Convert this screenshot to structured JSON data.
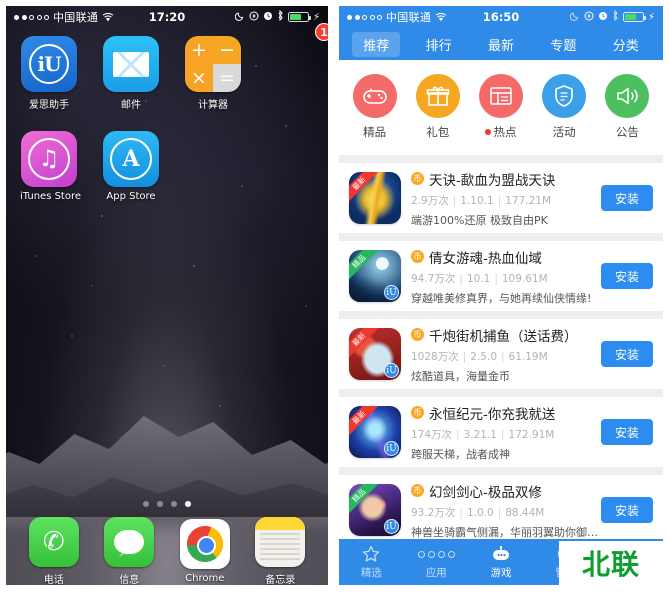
{
  "left_phone": {
    "status_bar": {
      "carrier": "中国联通",
      "signal_dots_filled": 2,
      "signal_dots_total": 5,
      "wifi_icon": "wifi-icon",
      "time": "17:20",
      "moon_icon": "do-not-disturb-icon",
      "rotation_lock_icon": "rotation-lock-icon",
      "alarm_icon": "alarm-icon",
      "bluetooth_icon": "bluetooth-icon",
      "battery_icon": "battery-icon",
      "charging_icon": "charging-bolt-icon"
    },
    "apps": [
      {
        "label": "爱思助手",
        "icon": "aisi-helper-icon",
        "glyph": "iU",
        "badge": "1"
      },
      {
        "label": "邮件",
        "icon": "mail-icon",
        "glyph": "",
        "badge": ""
      },
      {
        "label": "计算器",
        "icon": "calculator-icon",
        "keys": [
          "+",
          "−",
          "×",
          "="
        ],
        "badge": ""
      },
      {
        "label": "iTunes Store",
        "icon": "itunes-store-icon",
        "glyph": "♫",
        "badge": ""
      },
      {
        "label": "App Store",
        "icon": "app-store-icon",
        "glyph": "A",
        "badge": ""
      }
    ],
    "page_dots": {
      "total": 4,
      "active_index": 3
    },
    "dock": [
      {
        "label": "电话",
        "icon": "phone-icon",
        "glyph": "✆"
      },
      {
        "label": "信息",
        "icon": "messages-icon",
        "glyph": ""
      },
      {
        "label": "Chrome",
        "icon": "chrome-icon",
        "glyph": ""
      },
      {
        "label": "备忘录",
        "icon": "notes-icon",
        "glyph": ""
      }
    ]
  },
  "right_phone": {
    "status_bar": {
      "carrier": "中国联通",
      "signal_dots_filled": 2,
      "signal_dots_total": 5,
      "wifi_icon": "wifi-icon",
      "time": "16:50",
      "battery_icon": "battery-icon"
    },
    "tabs": [
      {
        "label": "推荐",
        "active": true
      },
      {
        "label": "排行",
        "active": false
      },
      {
        "label": "最新",
        "active": false
      },
      {
        "label": "专题",
        "active": false
      },
      {
        "label": "分类",
        "active": false
      }
    ],
    "categories": [
      {
        "label": "精品",
        "icon": "game-controller-icon",
        "color": "#f36a68",
        "dot": false
      },
      {
        "label": "礼包",
        "icon": "gift-box-icon",
        "color": "#f5a623",
        "dot": false
      },
      {
        "label": "热点",
        "icon": "hot-news-icon",
        "color": "#f36a68",
        "dot": true
      },
      {
        "label": "活动",
        "icon": "shield-activity-icon",
        "color": "#3aa0e8",
        "dot": false
      },
      {
        "label": "公告",
        "icon": "megaphone-icon",
        "color": "#4cbf5f",
        "dot": false
      }
    ],
    "apps": [
      {
        "ribbon": "最新",
        "ribbon_type": "new",
        "title": "天诀-歃血为盟战天诀",
        "downloads": "2.9万次",
        "version": "1.10.1",
        "size": "177.21M",
        "desc": "端游100%还原 极致自由PK",
        "install_label": "安装",
        "icon": "game-icon-tianjue"
      },
      {
        "ribbon": "精品",
        "ribbon_type": "fine",
        "title": "倩女游魂-热血仙域",
        "downloads": "94.7万次",
        "version": "10.1",
        "size": "109.61M",
        "desc": "穿越唯美修真界，与她再续仙侠情缘!",
        "install_label": "安装",
        "icon": "game-icon-qiannv"
      },
      {
        "ribbon": "最新",
        "ribbon_type": "new",
        "title": "千炮街机捕鱼（送话费）",
        "downloads": "1028万次",
        "version": "2.5.0",
        "size": "61.19M",
        "desc": "炫酷道具，海量金币",
        "install_label": "安装",
        "icon": "game-icon-buyu"
      },
      {
        "ribbon": "最新",
        "ribbon_type": "new",
        "title": "永恒纪元-你充我就送",
        "downloads": "174万次",
        "version": "3.21.1",
        "size": "172.91M",
        "desc": "跨服天梯，战者成神",
        "install_label": "安装",
        "icon": "game-icon-yongheng"
      },
      {
        "ribbon": "精品",
        "ribbon_type": "fine",
        "title": "幻剑剑心-极品双修",
        "downloads": "93.2万次",
        "version": "1.0.0",
        "size": "88.44M",
        "desc": "神兽坐骑霸气侧漏，华丽羽翼助你御气飞",
        "install_label": "安装",
        "icon": "game-icon-huanjian"
      }
    ],
    "bottom_nav": [
      {
        "label": "精选",
        "icon": "star-icon",
        "active": false,
        "dot": false
      },
      {
        "label": "应用",
        "icon": "grid-apps-icon",
        "active": false,
        "dot": false
      },
      {
        "label": "游戏",
        "icon": "robot-game-icon",
        "active": true,
        "dot": false
      },
      {
        "label": "管理",
        "icon": "clock-manage-icon",
        "active": false,
        "dot": false
      },
      {
        "label": "",
        "icon": "profile-circle-icon",
        "active": false,
        "dot": true
      }
    ]
  },
  "watermark": {
    "text": "北联",
    "color": "#0f9d2f"
  }
}
